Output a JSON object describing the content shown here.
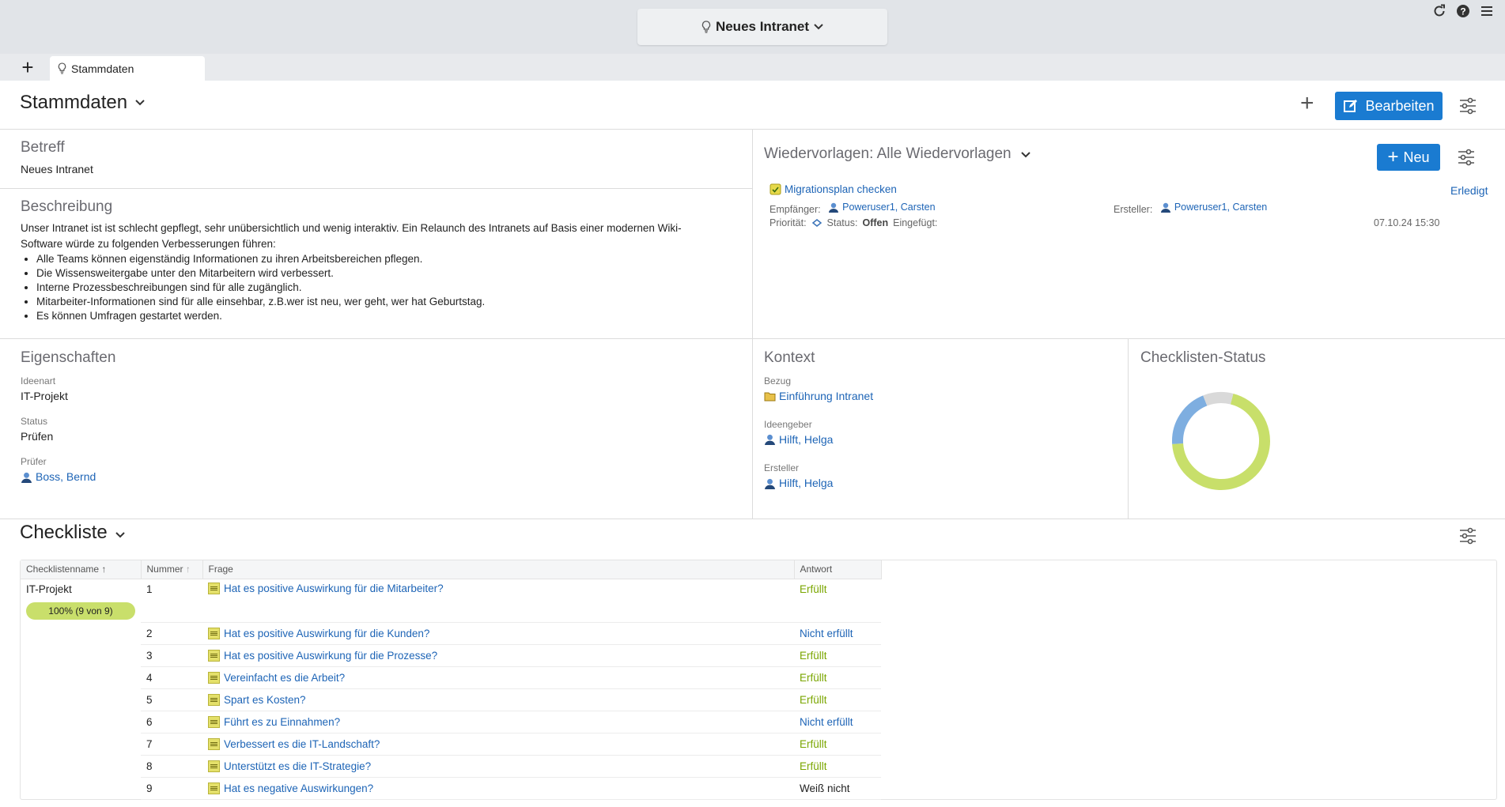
{
  "app": {
    "window_title": "Neues Intranet",
    "tab_label": "Stammdaten"
  },
  "header": {
    "title": "Stammdaten",
    "edit_label": "Bearbeiten"
  },
  "betreff": {
    "title": "Betreff",
    "value": "Neues Intranet"
  },
  "beschreibung": {
    "title": "Beschreibung",
    "intro_line1": "Unser Intranet ist ist schlecht gepflegt, sehr unübersichtlich und wenig interaktiv. Ein Relaunch des Intranets auf Basis einer modernen Wiki-",
    "intro_line2": "Software würde zu folgenden Verbesserungen führen:",
    "items": [
      "Alle Teams können eigenständig Informationen zu ihren Arbeitsbereichen pflegen.",
      "Die Wissensweitergabe unter den Mitarbeitern wird verbessert.",
      "Interne Prozessbeschreibungen sind für alle zugänglich.",
      "Mitarbeiter-Informationen sind für alle einsehbar, z.B.wer ist neu, wer geht, wer hat Geburtstag.",
      "Es können Umfragen gestartet werden."
    ]
  },
  "wiedervorlagen": {
    "title": "Wiedervorlagen: Alle Wiedervorlagen",
    "new_label": "Neu",
    "item": {
      "title": "Migrationsplan checken",
      "done_label": "Erledigt",
      "recipient_label": "Empfänger:",
      "recipient": "Poweruser1, Carsten",
      "creator_label": "Ersteller:",
      "creator": "Poweruser1, Carsten",
      "priority_label": "Priorität:",
      "status_label": "Status:",
      "status": "Offen",
      "inserted_label": "Eingefügt:",
      "datetime": "07.10.24 15:30"
    }
  },
  "eigenschaften": {
    "title": "Eigenschaften",
    "ideenart_label": "Ideenart",
    "ideenart": "IT-Projekt",
    "status_label": "Status",
    "status": "Prüfen",
    "pruefer_label": "Prüfer",
    "pruefer": "Boss, Bernd"
  },
  "kontext": {
    "title": "Kontext",
    "bezug_label": "Bezug",
    "bezug": "Einführung Intranet",
    "ideengeber_label": "Ideengeber",
    "ideengeber": "Hilft, Helga",
    "ersteller_label": "Ersteller",
    "ersteller": "Hilft, Helga"
  },
  "checklisten_status": {
    "title": "Checklisten-Status",
    "chart_data": {
      "type": "pie",
      "segments": [
        {
          "value": 7,
          "color": "#c8df6a"
        },
        {
          "value": 2,
          "color": "#7eaee0"
        },
        {
          "value": 1,
          "color": "#d9d9d9"
        }
      ]
    }
  },
  "checkliste": {
    "title": "Checkliste",
    "columns": [
      "Checklistenname",
      "Nummer",
      "Frage",
      "Antwort"
    ],
    "name": "IT-Projekt",
    "progress_label": "100% (9 von 9)",
    "rows": [
      {
        "num": "1",
        "question": "Hat es positive Auswirkung für die Mitarbeiter?",
        "answer": "Erfüllt",
        "kind": "ok"
      },
      {
        "num": "2",
        "question": "Hat es positive Auswirkung für die Kunden?",
        "answer": "Nicht erfüllt",
        "kind": "no"
      },
      {
        "num": "3",
        "question": "Hat es positive Auswirkung für die Prozesse?",
        "answer": "Erfüllt",
        "kind": "ok"
      },
      {
        "num": "4",
        "question": "Vereinfacht es die Arbeit?",
        "answer": "Erfüllt",
        "kind": "ok"
      },
      {
        "num": "5",
        "question": "Spart es Kosten?",
        "answer": "Erfüllt",
        "kind": "ok"
      },
      {
        "num": "6",
        "question": "Führt es zu Einnahmen?",
        "answer": "Nicht erfüllt",
        "kind": "no"
      },
      {
        "num": "7",
        "question": "Verbessert es die IT-Landschaft?",
        "answer": "Erfüllt",
        "kind": "ok"
      },
      {
        "num": "8",
        "question": "Unterstützt es die IT-Strategie?",
        "answer": "Erfüllt",
        "kind": "ok"
      },
      {
        "num": "9",
        "question": "Hat es negative Auswirkungen?",
        "answer": "Weiß nicht",
        "kind": "unk"
      }
    ]
  }
}
